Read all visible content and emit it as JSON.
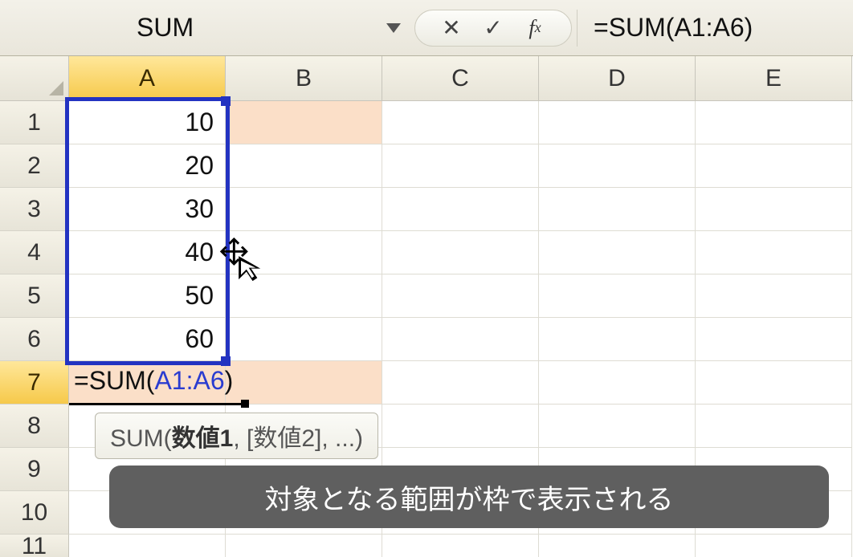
{
  "nameBox": "SUM",
  "formulaBar": "=SUM(A1:A6)",
  "columns": [
    "A",
    "B",
    "C",
    "D",
    "E"
  ],
  "activeColumn": "A",
  "rows": [
    "1",
    "2",
    "3",
    "4",
    "5",
    "6",
    "7",
    "8",
    "9",
    "10",
    "11"
  ],
  "activeRow": "7",
  "cells": {
    "A1": "10",
    "A2": "20",
    "A3": "30",
    "A4": "40",
    "A5": "50",
    "A6": "60"
  },
  "editCell": {
    "prefix": "=SUM(",
    "ref": "A1:A6",
    "suffix": ")"
  },
  "tooltip": {
    "fn": "SUM(",
    "arg1": "数値1",
    "rest": ", [数値2], ...)"
  },
  "annotation": "対象となる範囲が枠で表示される",
  "chart_data": {
    "type": "table",
    "title": "Excel SUM range A1:A6",
    "categories": [
      "A1",
      "A2",
      "A3",
      "A4",
      "A5",
      "A6"
    ],
    "values": [
      10,
      20,
      30,
      40,
      50,
      60
    ],
    "formula": "=SUM(A1:A6)"
  }
}
